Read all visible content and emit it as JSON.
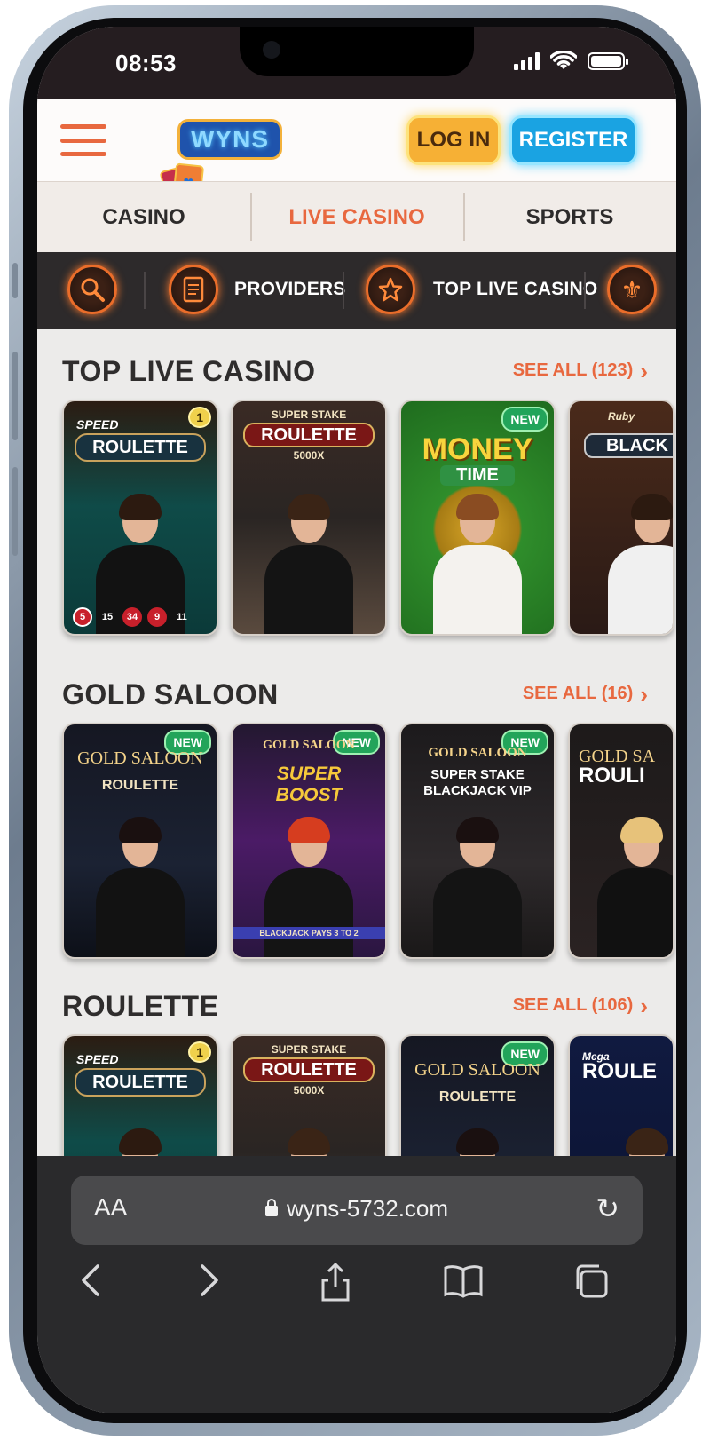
{
  "status": {
    "time": "08:53"
  },
  "header": {
    "logo_text": "WYNS",
    "login_label": "LOG IN",
    "register_label": "REGISTER"
  },
  "main_nav": [
    "CASINO",
    "LIVE CASINO",
    "SPORTS"
  ],
  "sub_nav": {
    "providers_label": "PROVIDERS",
    "top_live_label": "TOP LIVE CASINO"
  },
  "sections": [
    {
      "title": "TOP LIVE CASINO",
      "see_all": "SEE ALL (123)",
      "cards": [
        {
          "brand": "SPEED",
          "title": "ROULETTE",
          "numbers": [
            "5",
            "15",
            "34",
            "9",
            "11"
          ],
          "badge": "1"
        },
        {
          "brand": "SUPER STAKE",
          "title": "ROULETTE",
          "sub": "5000X"
        },
        {
          "title": "MONEY",
          "sub": "TIME",
          "badge": "NEW"
        },
        {
          "brand": "Ruby",
          "title": "BLACK"
        }
      ]
    },
    {
      "title": "GOLD SALOON",
      "see_all": "SEE ALL (16)",
      "cards": [
        {
          "brand": "GOLD SALOON",
          "title": "ROULETTE",
          "badge": "NEW"
        },
        {
          "brand": "GOLD SALOON",
          "title": "SUPER BOOST",
          "sub": "BLACKJACK PAYS 3 TO 2",
          "badge": "NEW"
        },
        {
          "brand": "GOLD SALOON",
          "title": "SUPER STAKE",
          "sub": "BLACKJACK VIP",
          "badge": "NEW"
        },
        {
          "brand": "GOLD SA",
          "title": "ROULI"
        }
      ]
    },
    {
      "title": "ROULETTE",
      "see_all": "SEE ALL (106)",
      "cards": [
        {
          "brand": "SPEED",
          "title": "ROULETTE",
          "badge": "1"
        },
        {
          "brand": "SUPER STAKE",
          "title": "ROULETTE",
          "sub": "5000X"
        },
        {
          "brand": "GOLD SALOON",
          "title": "ROULETTE",
          "badge": "NEW"
        },
        {
          "brand": "Mega",
          "title": "ROULE"
        }
      ]
    }
  ],
  "browser": {
    "aa": "AA",
    "url": "wyns-5732.com"
  },
  "colors": {
    "accent": "#e8683f",
    "login": "#f6b035",
    "register": "#1aa3e2",
    "badge_new": "#22a45a"
  }
}
